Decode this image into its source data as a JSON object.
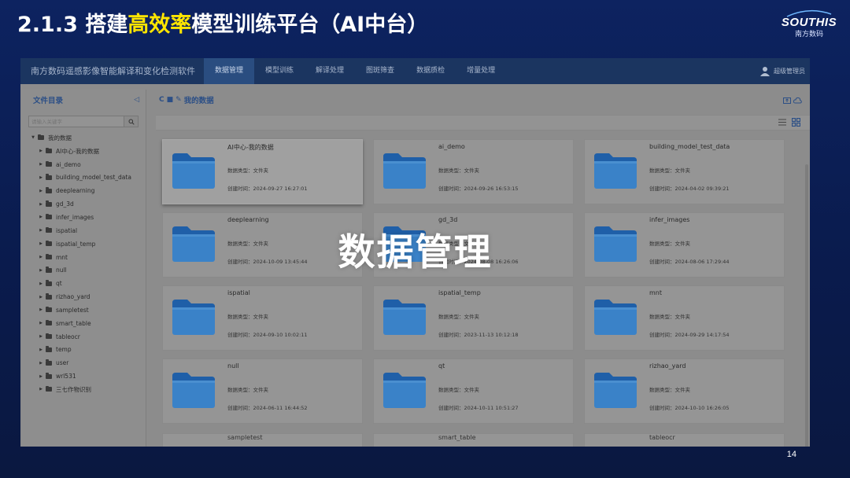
{
  "slide": {
    "title_before": "2.1.3 搭建",
    "title_highlight": "高效率",
    "title_after": "模型训练平台（AI中台）",
    "logo_brand": "SOUTHIS",
    "logo_sub": "南方数码",
    "page_number": "14",
    "highlight_color": "#ffe600"
  },
  "app": {
    "name": "南方数码遥感影像智能解译和变化检测软件",
    "nav": [
      {
        "label": "数据管理",
        "active": true
      },
      {
        "label": "模型训练"
      },
      {
        "label": "解译处理"
      },
      {
        "label": "图斑筛查"
      },
      {
        "label": "数据质检"
      },
      {
        "label": "增量处理"
      }
    ],
    "user": "超级管理员"
  },
  "sidebar": {
    "title": "文件目录",
    "search_placeholder": "请输入关键字",
    "root": "我的数据",
    "items": [
      "AI中心-我的数据",
      "ai_demo",
      "building_model_test_data",
      "deeplearning",
      "gd_3d",
      "infer_images",
      "ispatial",
      "ispatial_temp",
      "mnt",
      "null",
      "qt",
      "rizhao_yard",
      "sampletest",
      "smart_table",
      "tableocr",
      "temp",
      "user",
      "wrl531",
      "三七作物识别"
    ]
  },
  "content": {
    "breadcrumb": "我的数据",
    "type_label": "数据类型：",
    "time_label": "创建时间：",
    "cards": [
      {
        "name": "AI中心-我的数据",
        "type": "文件夹",
        "time": "2024-09-27 16:27:01"
      },
      {
        "name": "ai_demo",
        "type": "文件夹",
        "time": "2024-09-26 16:53:15"
      },
      {
        "name": "building_model_test_data",
        "type": "文件夹",
        "time": "2024-04-02 09:39:21"
      },
      {
        "name": "deeplearning",
        "type": "文件夹",
        "time": "2024-10-09 13:45:44"
      },
      {
        "name": "gd_3d",
        "type": "文件夹",
        "time": "2024-08-08 16:26:06"
      },
      {
        "name": "infer_images",
        "type": "文件夹",
        "time": "2024-08-06 17:29:44"
      },
      {
        "name": "ispatial",
        "type": "文件夹",
        "time": "2024-09-10 10:02:11"
      },
      {
        "name": "ispatial_temp",
        "type": "文件夹",
        "time": "2023-11-13 10:12:18"
      },
      {
        "name": "mnt",
        "type": "文件夹",
        "time": "2024-09-29 14:17:54"
      },
      {
        "name": "null",
        "type": "文件夹",
        "time": "2024-06-11 16:44:52"
      },
      {
        "name": "qt",
        "type": "文件夹",
        "time": "2024-10-11 10:51:27"
      },
      {
        "name": "rizhao_yard",
        "type": "文件夹",
        "time": "2024-10-10 16:26:05"
      }
    ],
    "partial_cards": [
      "sampletest",
      "smart_table",
      "tableocr"
    ]
  },
  "overlay": "数据管理"
}
